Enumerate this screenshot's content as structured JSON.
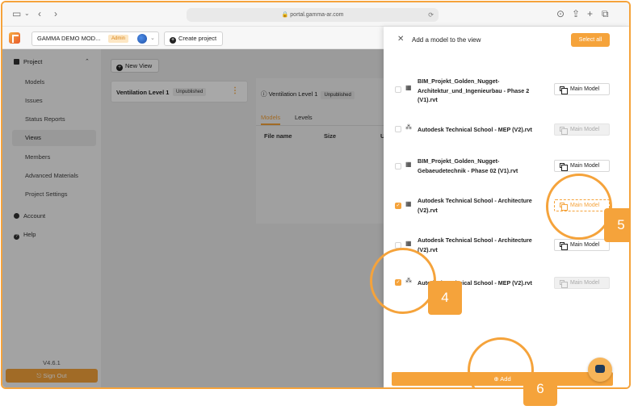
{
  "browser": {
    "url": "portal.gamma-ar.com"
  },
  "topbar": {
    "project_name": "GAMMA DEMO MOD...",
    "role_badge": "Admin",
    "create_project": "Create project"
  },
  "sidebar": {
    "section": "Project",
    "items": [
      "Models",
      "Issues",
      "Status Reports",
      "Views",
      "Members",
      "Advanced Materials",
      "Project Settings"
    ],
    "active_item": "Views",
    "account": "Account",
    "help": "Help",
    "version": "V4.6.1",
    "sign_out": "Sign Out"
  },
  "center": {
    "new_view": "New View",
    "view_name": "Ventilation Level 1",
    "view_status": "Unpublished",
    "detail_title": "Ventilation Level 1",
    "detail_status": "Unpublished",
    "tabs": [
      "Models",
      "Levels"
    ],
    "columns": [
      "File name",
      "Size",
      "U"
    ]
  },
  "panel": {
    "title": "Add a model to the view",
    "select_all": "Select all",
    "add": "Add",
    "models": [
      {
        "name": "BIM_Projekt_Golden_Nugget-Architektur_und_Ingenieurbau - Phase 2 (V1).rvt",
        "icon": "building-icon",
        "checked": false,
        "button": "Main Model",
        "state": "normal"
      },
      {
        "name": "Autodesk Technical School - MEP (V2).rvt",
        "icon": "mep-icon",
        "checked": false,
        "button": "Main Model",
        "state": "disabled"
      },
      {
        "name": "BIM_Projekt_Golden_Nugget-Gebaeudetechnik - Phase 02 (V1).rvt",
        "icon": "building-icon",
        "checked": false,
        "button": "Main Model",
        "state": "normal"
      },
      {
        "name": "Autodesk Technical School - Architecture (V2).rvt",
        "icon": "building-icon",
        "checked": true,
        "button": "Main Model",
        "state": "highlighted"
      },
      {
        "name": "Autodesk Technical School - Architecture (V2).rvt",
        "icon": "building-icon",
        "checked": false,
        "button": "Main Model",
        "state": "normal"
      },
      {
        "name": "Autodesk Technical School - MEP (V2).rvt",
        "icon": "mep-icon",
        "checked": true,
        "button": "Main Model",
        "state": "disabled"
      }
    ]
  },
  "annotations": {
    "steps": [
      "4",
      "5",
      "6"
    ]
  },
  "colors": {
    "accent": "#f5a33b"
  }
}
